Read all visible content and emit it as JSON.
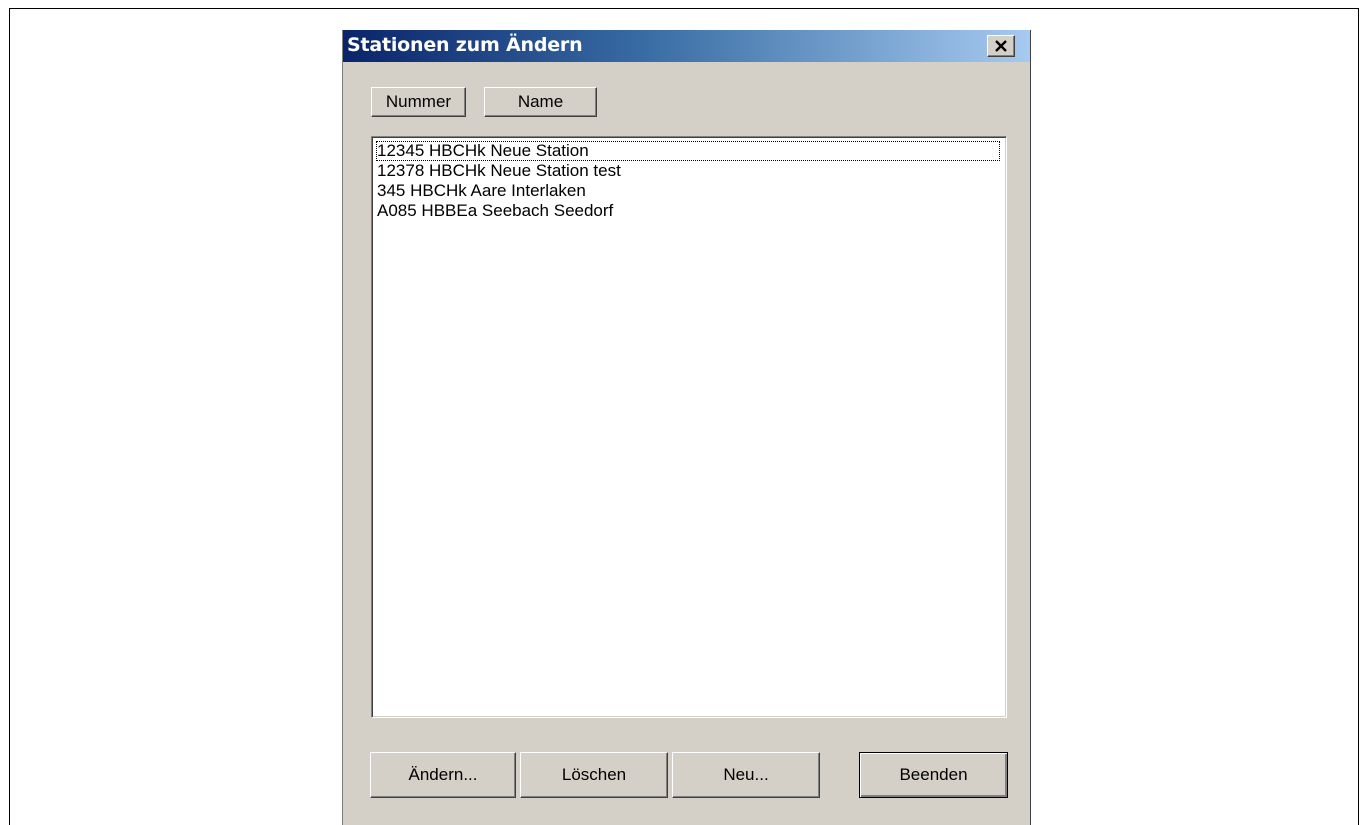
{
  "dialog": {
    "title": "Stationen zum Ändern",
    "close_label": "×"
  },
  "sort_buttons": {
    "number_label": "Nummer",
    "name_label": "Name"
  },
  "stations": [
    "12345 HBCHk Neue Station",
    "12378 HBCHk Neue Station test",
    "345 HBCHk Aare Interlaken",
    "A085 HBBEa Seebach Seedorf"
  ],
  "actions": {
    "edit_label": "Ändern...",
    "delete_label": "Löschen",
    "new_label": "Neu...",
    "exit_label": "Beenden"
  }
}
